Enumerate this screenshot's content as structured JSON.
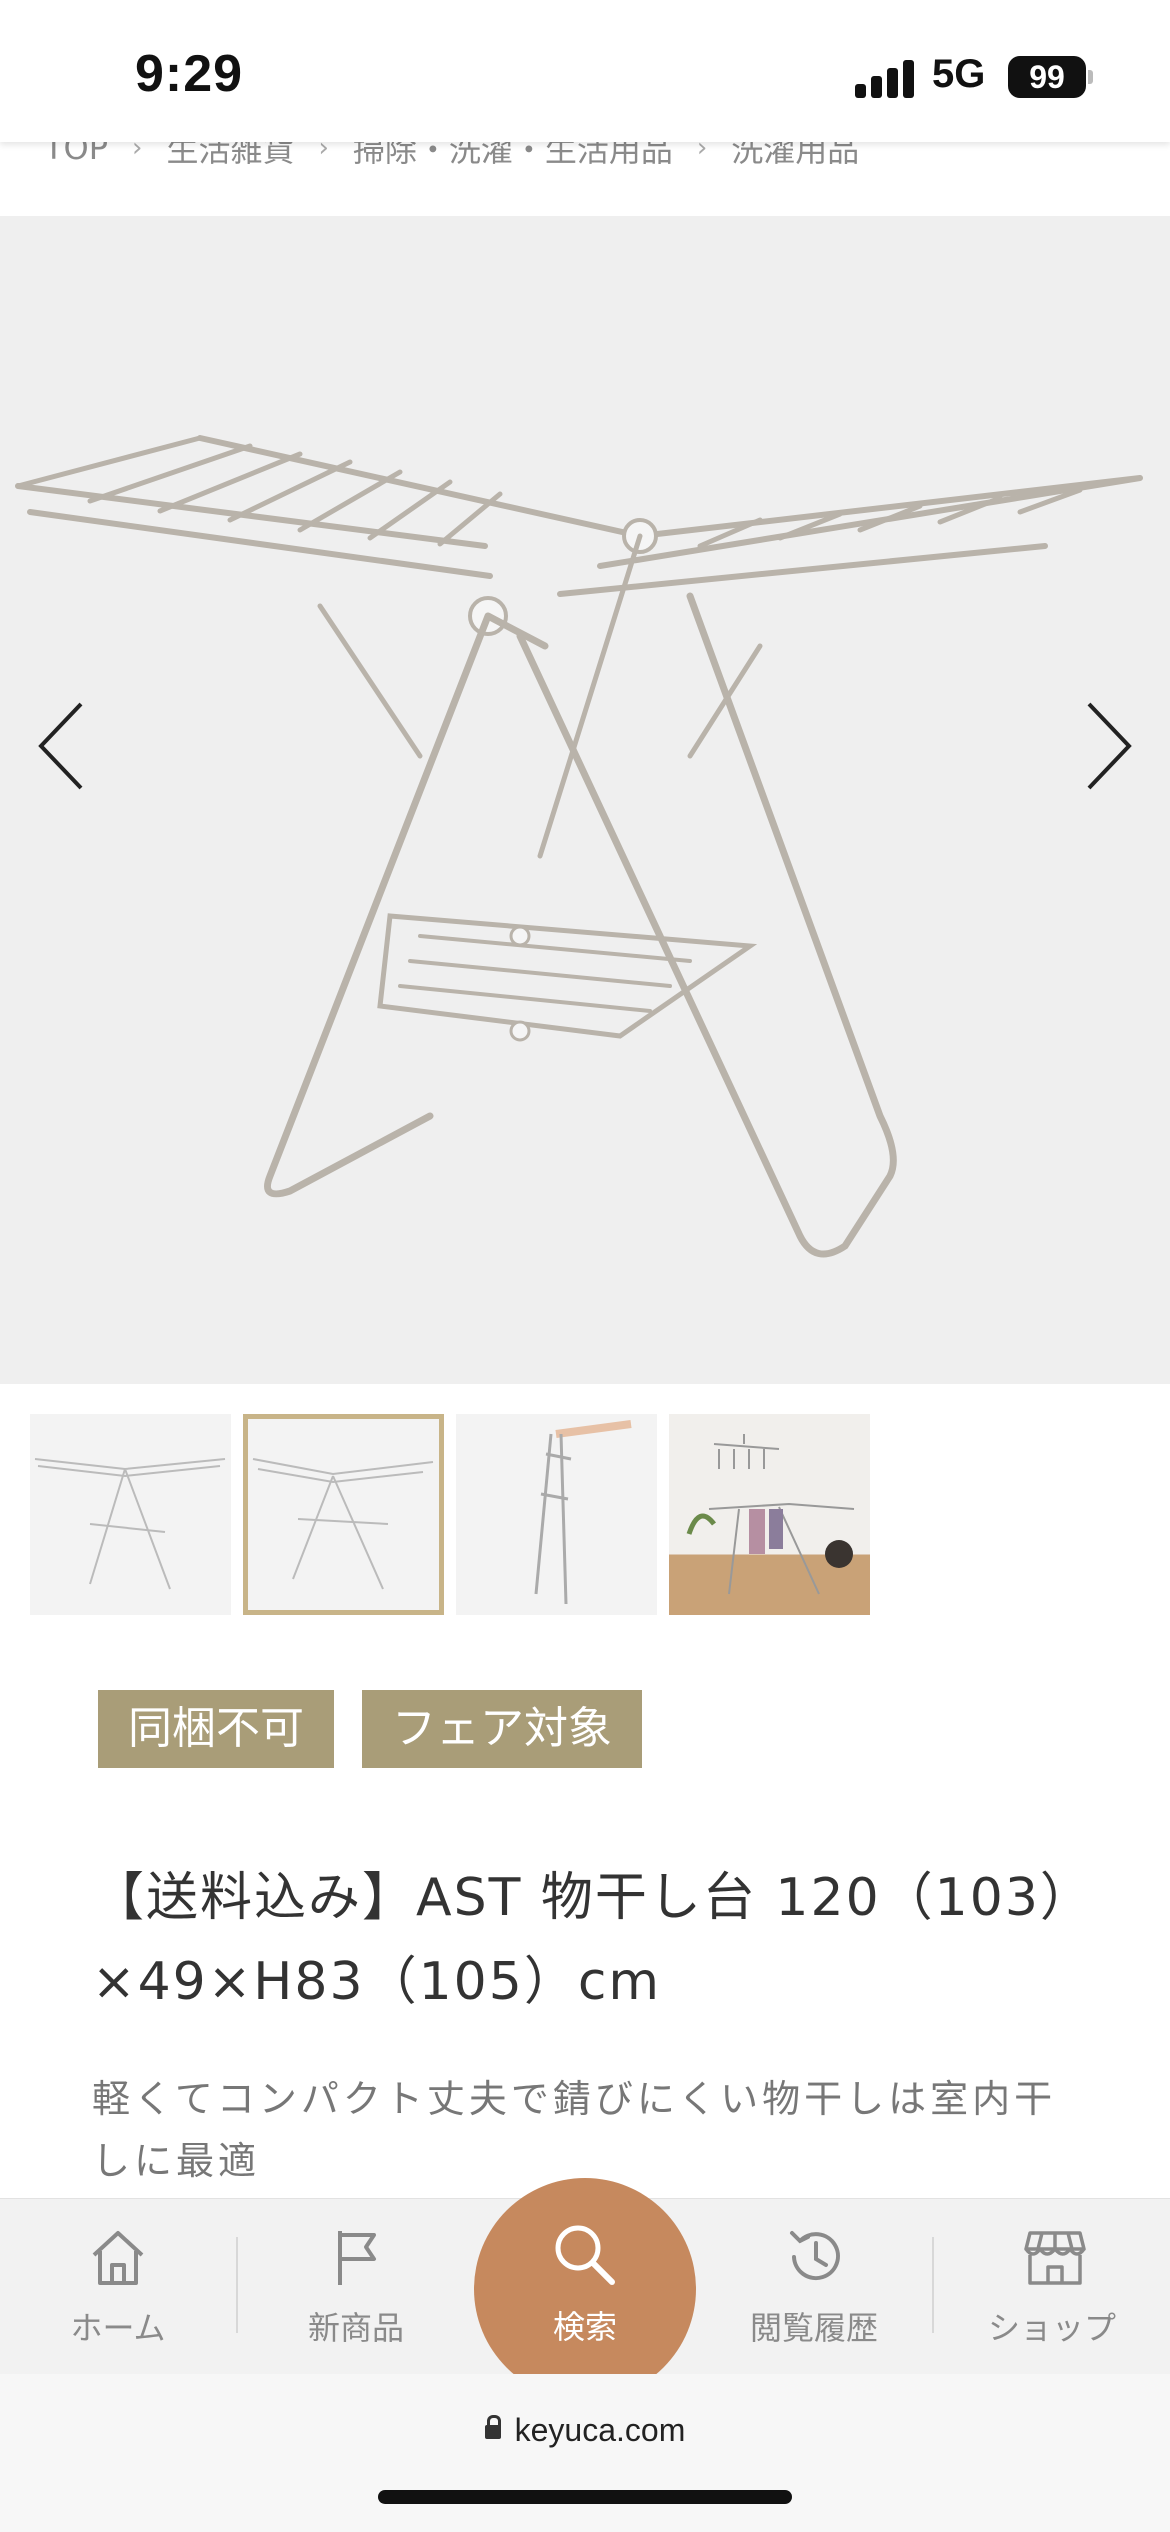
{
  "status_bar": {
    "time": "9:29",
    "network": "5G",
    "battery": "99"
  },
  "breadcrumb": {
    "items": [
      "TOP",
      "生活雑貨",
      "掃除・洗濯・生活用品",
      "洗濯用品"
    ],
    "separator": "›"
  },
  "gallery": {
    "prev_icon": "chevron-left-icon",
    "next_icon": "chevron-right-icon",
    "thumbnail_count": 4,
    "active_thumbnail_index": 1
  },
  "tags": [
    "同梱不可",
    "フェア対象"
  ],
  "product": {
    "title": "【送料込み】AST 物干し台 120（103）×49×H83（105）cm",
    "description": "軽くてコンパクト丈夫で錆びにくい物干しは室内干しに最適"
  },
  "tabbar": {
    "home": "ホーム",
    "new": "新商品",
    "search": "検索",
    "history": "閲覧履歴",
    "shop": "ショップ"
  },
  "browser": {
    "url": "keyuca.com"
  },
  "colors": {
    "tag_bg": "#a99d78",
    "search_fab": "#c6895e",
    "active_thumb_border": "#c8b488"
  }
}
